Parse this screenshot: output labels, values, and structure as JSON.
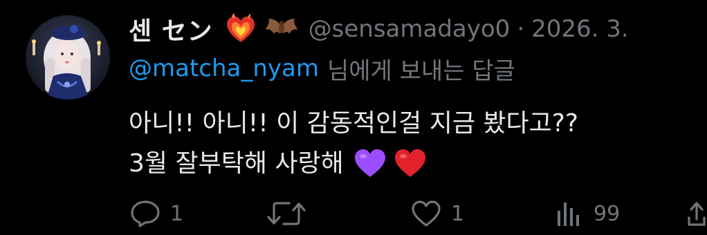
{
  "tweet": {
    "display_name": "센 セン",
    "name_emojis": [
      "heart-on-fire-emoji",
      "bat-emoji"
    ],
    "handle": "@sensamadayo0",
    "separator": "·",
    "date": "2026. 3.",
    "reply_to": "@matcha_nyam",
    "reply_suffix": "님에게 보내는 답글",
    "body_line1": "아니!! 아니!! 이 감동적인걸 지금 봤다고??",
    "body_line2": "3월 잘부탁해 사랑해",
    "body_emojis": [
      "purple-heart-emoji",
      "red-heart-emoji"
    ]
  },
  "actions": {
    "reply_count": "1",
    "retweet_count": "",
    "like_count": "1",
    "view_count": "99"
  },
  "colors": {
    "background": "#000000",
    "text": "#e7e9ea",
    "muted": "#71767b",
    "link": "#1d9bf0"
  }
}
